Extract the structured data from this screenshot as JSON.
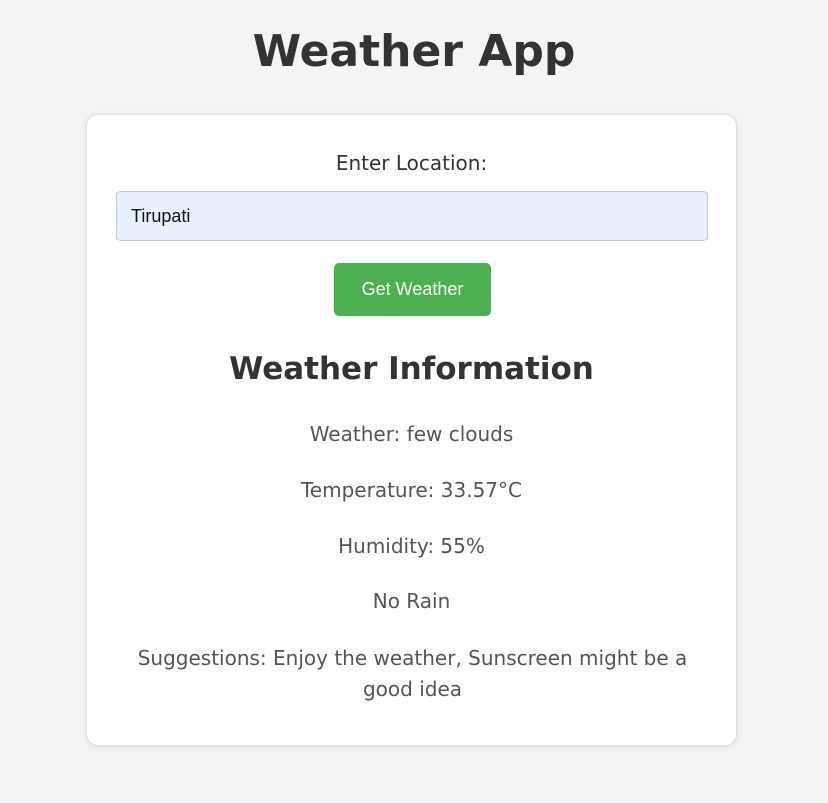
{
  "app": {
    "title": "Weather App"
  },
  "form": {
    "location_label": "Enter Location:",
    "location_value": "Tirupati",
    "submit_label": "Get Weather"
  },
  "weather_info": {
    "heading": "Weather Information",
    "condition": "Weather: few clouds",
    "temperature": "Temperature: 33.57°C",
    "humidity": "Humidity: 55%",
    "rain": "No Rain",
    "suggestions": "Suggestions: Enjoy the weather, Sunscreen might be a good idea"
  },
  "colors": {
    "background": "#f4f4f4",
    "card": "#ffffff",
    "button": "#4caf50",
    "input_autofill": "#e8f0fe",
    "heading_text": "#333333",
    "info_text": "#555555"
  }
}
